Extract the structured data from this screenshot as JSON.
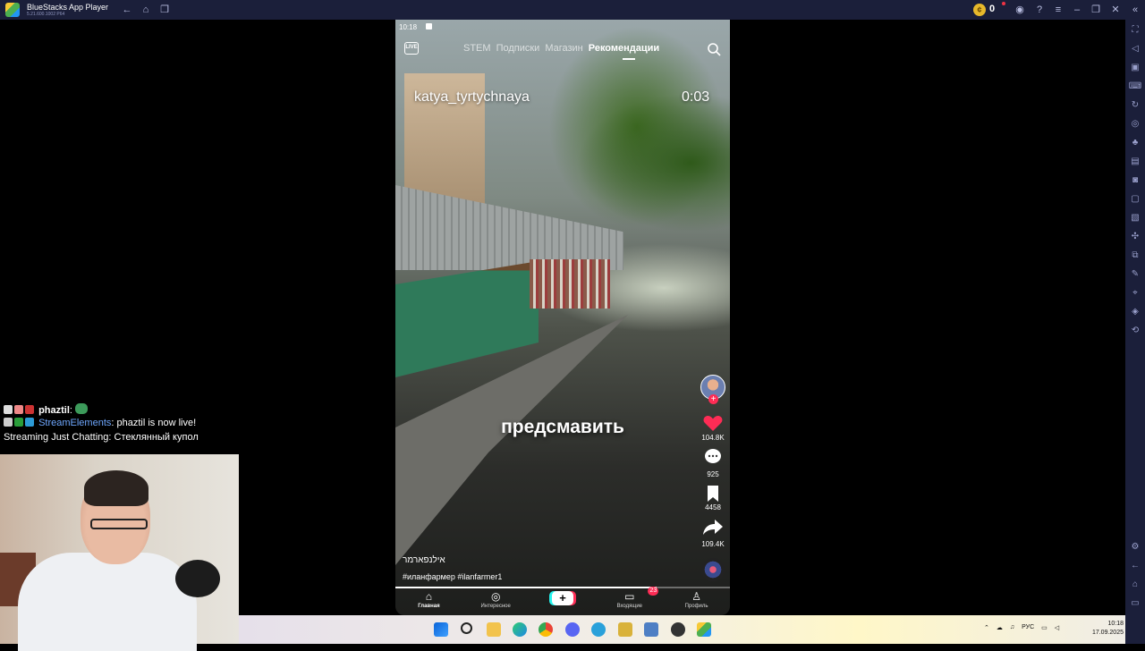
{
  "window": {
    "title": "BlueStacks App Player",
    "version": "5.21.600.1002 P64",
    "coins": "0"
  },
  "phone": {
    "status_time": "10:18",
    "tabs": [
      {
        "label": "STEM"
      },
      {
        "label": "Подписки"
      },
      {
        "label": "Магазин"
      },
      {
        "label": "Рекомендации"
      }
    ],
    "video": {
      "username": "katya_tyrtychnaya",
      "timer": "0:03",
      "caption": "предсмавить",
      "author_line": "אילנפארמר",
      "hashtags": "#иланфармер #ilanfarmer1",
      "progress": 0.78
    },
    "actions": {
      "likes": "104.8K",
      "comments": "925",
      "saves": "4458",
      "shares": "109.4K"
    },
    "bottom_nav": [
      {
        "label": "Главная",
        "icon": "home-icon"
      },
      {
        "label": "Интересное",
        "icon": "compass-icon"
      },
      {
        "label": "",
        "icon": "plus-icon"
      },
      {
        "label": "Входящие",
        "icon": "inbox-icon",
        "badge": "23"
      },
      {
        "label": "Профиль",
        "icon": "profile-icon"
      }
    ]
  },
  "chat": {
    "line1": {
      "user": "phaztil",
      "sep": ":"
    },
    "line2": {
      "user": "StreamElements",
      "message": ": phaztil is now live!"
    },
    "line3": {
      "message": "Streaming Just Chatting: Стеклянный купол"
    }
  },
  "taskbar": {
    "language": "РУС",
    "time": "10:18",
    "date": "17.09.2025"
  },
  "colors": {
    "accent_red": "#fe2c55",
    "accent_cyan": "#25f4ee",
    "bluestacks_bar": "#1b1f3a"
  }
}
